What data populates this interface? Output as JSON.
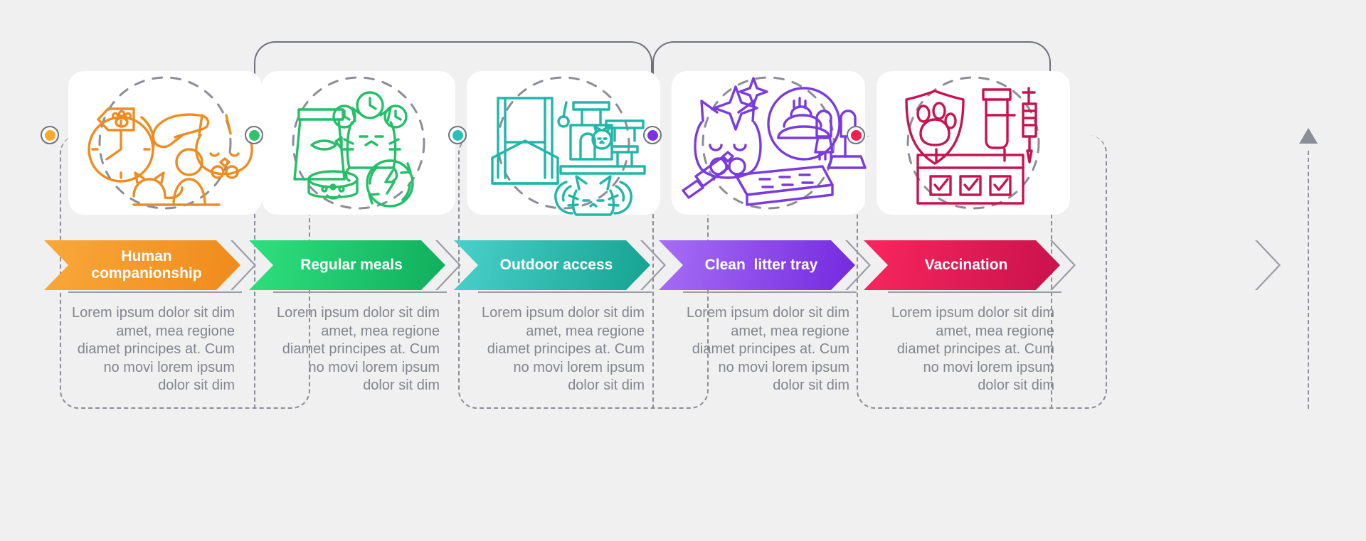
{
  "infographic": {
    "type": "process-steps",
    "step_count": 5,
    "background_color": "#f0f0f0",
    "connector_color": "#6f717c",
    "body_text_color": "#83858f"
  },
  "steps": [
    {
      "index": 1,
      "label": "Human\ncompanionship",
      "color": "#f7941e",
      "color_dark": "#ef7f1a",
      "dot_color": "#f8ab2b",
      "icon_name": "clock-hand-petting-cat-icon",
      "description": "Lorem ipsum dolor sit dim amet, mea regione diamet principes at. Cum no movi lorem ipsum dolor sit dim"
    },
    {
      "index": 2,
      "label": "Regular meals",
      "color": "#2ad573",
      "color_dark": "#13b05f",
      "dot_color": "#2fc46c",
      "icon_name": "cat-food-bag-bowl-clock-icon",
      "description": "Lorem ipsum dolor sit dim amet, mea regione diamet principes at. Cum no movi lorem ipsum dolor sit dim"
    },
    {
      "index": 3,
      "label": "Outdoor access",
      "color": "#3ec9c1",
      "color_dark": "#19a893",
      "dot_color": "#25c3b5",
      "icon_name": "window-cat-tree-hands-icon",
      "description": "Lorem ipsum dolor sit dim amet, mea regione diamet principes at. Cum no movi lorem ipsum dolor sit dim"
    },
    {
      "index": 4,
      "label": "Clean  litter tray",
      "color": "#9b5ef0",
      "color_dark": "#7a32e0",
      "dot_color": "#7c32e0",
      "icon_name": "sparkling-cat-litter-scoop-icon",
      "description": "Lorem ipsum dolor sit dim amet, mea regione diamet principes at. Cum no movi lorem ipsum dolor sit dim"
    },
    {
      "index": 5,
      "label": "Vaccination",
      "color": "#f32357",
      "color_dark": "#c4124d",
      "dot_color": "#ef1f4e",
      "icon_name": "paw-shield-vaccine-calendar-icon",
      "description": "Lorem ipsum dolor sit dim amet, mea regione diamet principes at. Cum no movi lorem ipsum dolor sit dim"
    }
  ],
  "end_marker": {
    "icon_name": "up-triangle-arrow-icon",
    "color": "#8b8d98"
  }
}
